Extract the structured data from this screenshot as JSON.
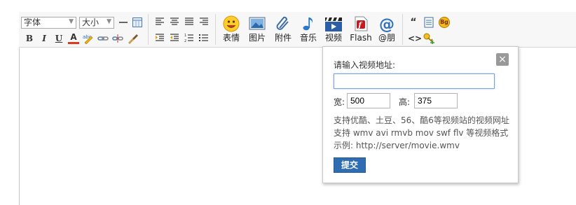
{
  "toolbar": {
    "font_family": "字体",
    "font_size": "大小",
    "format_buttons": {
      "bold": "B",
      "italic": "I",
      "underline": "U",
      "font_color": "A"
    },
    "big_buttons": [
      {
        "label": "表情",
        "icon": "smiley-icon"
      },
      {
        "label": "图片",
        "icon": "image-icon"
      },
      {
        "label": "附件",
        "icon": "paperclip-icon"
      },
      {
        "label": "音乐",
        "icon": "music-note-icon"
      },
      {
        "label": "视频",
        "icon": "video-clapper-icon"
      },
      {
        "label": "Flash",
        "icon": "flash-icon"
      },
      {
        "label": "@朋",
        "icon": "at-icon"
      }
    ],
    "right_buttons": {
      "quote": "“",
      "code": "<>",
      "bg": "Bg"
    }
  },
  "video_dialog": {
    "title": "请输入视频地址:",
    "url_value": "",
    "width_label": "宽:",
    "width_value": "500",
    "height_label": "高:",
    "height_value": "375",
    "tips": [
      "支持优酷、土豆、56、酷6等视频站的视频网址",
      "支持 wmv avi rmvb mov swf flv 等视频格式",
      "示例: http://server/movie.wmv"
    ],
    "submit_label": "提交",
    "close_label": "×"
  },
  "colors": {
    "accent": "#2f6db3",
    "close": "#999999"
  }
}
